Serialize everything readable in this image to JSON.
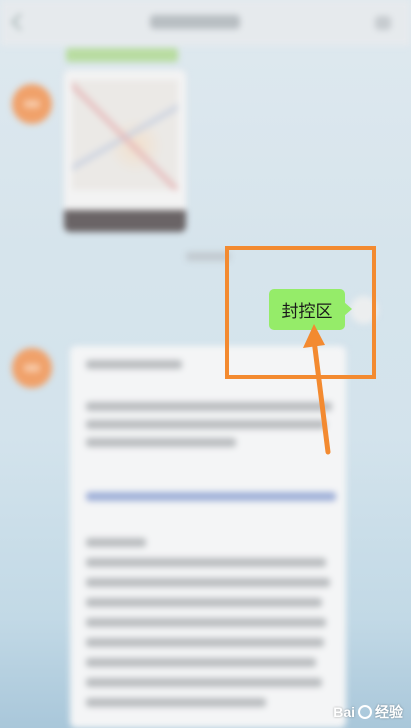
{
  "chat": {
    "highlighted_message": "封控区",
    "bubble_color": "#95ec69",
    "accent_color": "#f38a30"
  },
  "watermark": {
    "brand": "Bai",
    "suffix": "经验"
  }
}
